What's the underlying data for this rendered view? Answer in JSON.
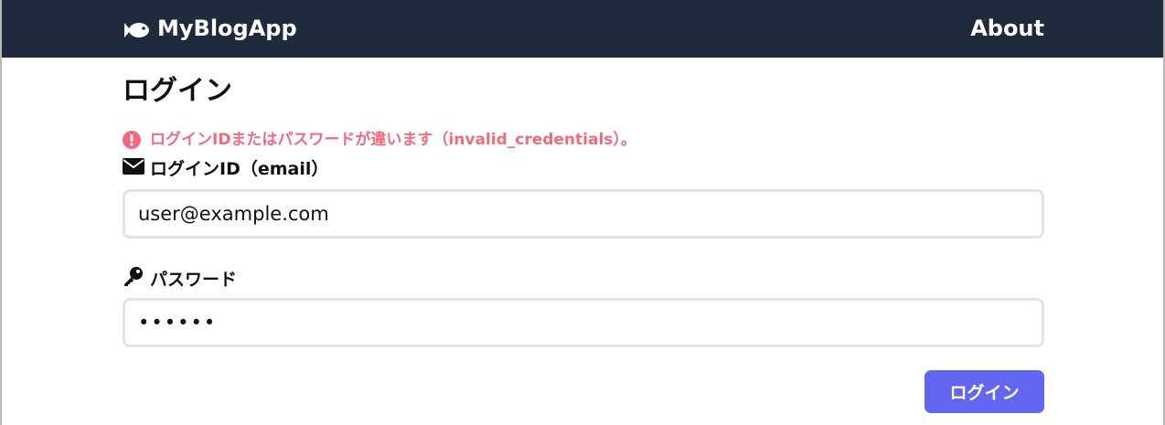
{
  "navbar": {
    "brand": "MyBlogApp",
    "brand_icon": "fish-icon",
    "about_label": "About",
    "background": "#1f2a3d"
  },
  "page": {
    "title": "ログイン"
  },
  "error": {
    "icon": "exclamation-circle-icon",
    "message": "ログインIDまたはパスワードが違います（invalid_credentials）。",
    "color": "#f06b7e"
  },
  "form": {
    "email_label": "ログインID（email）",
    "email_icon": "envelope-icon",
    "email_value": "user@example.com",
    "password_label": "パスワード",
    "password_icon": "key-icon",
    "password_value": "dummy1",
    "submit_label": "ログイン",
    "submit_color": "#6366f1"
  }
}
